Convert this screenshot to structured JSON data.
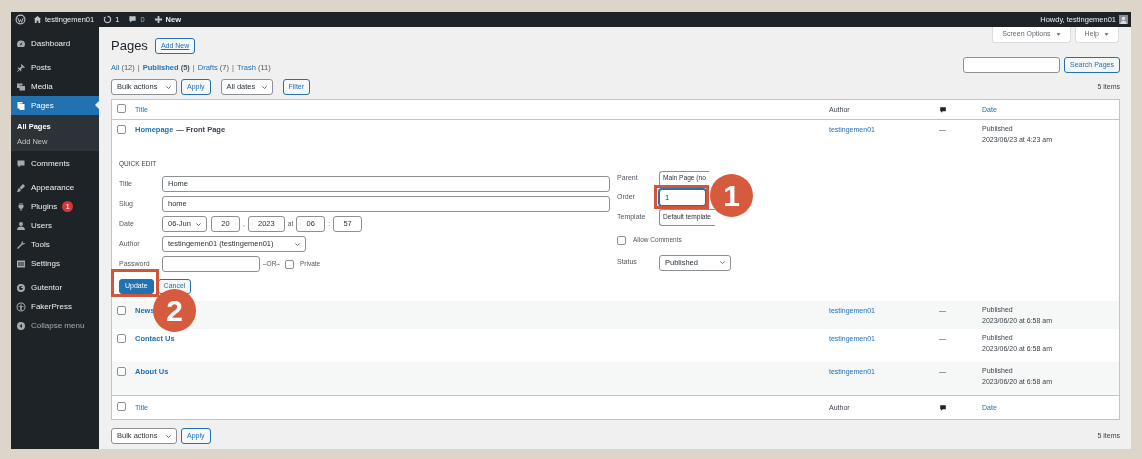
{
  "admin_bar": {
    "site_name": "testingemen01",
    "updates": "1",
    "comments": "0",
    "new_label": "New",
    "greeting": "Howdy, testingemen01"
  },
  "sidebar": {
    "groups": [
      {
        "items": [
          {
            "label": "Dashboard",
            "selected": false
          }
        ]
      },
      {
        "items": [
          {
            "label": "Posts",
            "selected": false
          },
          {
            "label": "Media",
            "selected": false
          },
          {
            "label": "Pages",
            "selected": true,
            "children": [
              {
                "label": "All Pages",
                "selected": true
              },
              {
                "label": "Add New",
                "selected": false
              }
            ]
          },
          {
            "label": "Comments",
            "selected": false
          }
        ]
      },
      {
        "items": [
          {
            "label": "Appearance",
            "selected": false
          },
          {
            "label": "Plugins",
            "selected": false,
            "badge": "1"
          },
          {
            "label": "Users",
            "selected": false
          },
          {
            "label": "Tools",
            "selected": false
          },
          {
            "label": "Settings",
            "selected": false
          }
        ]
      },
      {
        "items": [
          {
            "label": "Gutentor",
            "selected": false
          },
          {
            "label": "FakerPress",
            "selected": false
          },
          {
            "label": "Collapse menu",
            "selected": false,
            "kind": "collapse"
          }
        ]
      }
    ]
  },
  "screen_options": "Screen Options",
  "help": "Help",
  "page": {
    "title": "Pages",
    "add_new": "Add New"
  },
  "filters": [
    {
      "label": "All",
      "count": "(12)",
      "selected": false,
      "separator": "|"
    },
    {
      "label": "Published",
      "count": "(5)",
      "selected": true,
      "separator": "|"
    },
    {
      "label": "Drafts",
      "count": "(7)",
      "selected": false,
      "separator": "|"
    },
    {
      "label": "Trash",
      "count": "(11)",
      "selected": false
    }
  ],
  "search": {
    "button": "Search Pages"
  },
  "top_actions": {
    "bulk": "Bulk actions",
    "apply": "Apply",
    "dates": "All dates",
    "filter": "Filter",
    "count": "5 items"
  },
  "table": {
    "header": {
      "checked": false,
      "title": "Title",
      "author": "Author",
      "date": "Date"
    },
    "rows": [
      {
        "kind": "page",
        "checked": false,
        "title": "Homepage",
        "state": "— Front Page",
        "author": "testingemen01",
        "comments": "—",
        "status": "Published",
        "date": "2023/06/23 at 4:23 am"
      },
      {
        "kind": "quick_edit",
        "heading": "QUICK EDIT",
        "title_label": "Title",
        "title": "Home",
        "slug_label": "Slug",
        "slug": "home",
        "date_label": "Date",
        "month": "06-Jun",
        "day": "20",
        "day_sep": ",",
        "year": "2023",
        "at": "at",
        "hour": "06",
        "time_sep": ":",
        "minute": "57",
        "author_label": "Author",
        "author": "testingemen01 (testingemen01)",
        "password_label": "Password",
        "or": "–OR–",
        "private_label": "Private",
        "private": false,
        "parent_label": "Parent",
        "parent": "Main Page (no",
        "order_label": "Order",
        "order": "1",
        "template_label": "Template",
        "template": "Default template",
        "allow_comments_label": "Allow Comments",
        "allow_comments": false,
        "status_label": "Status",
        "status": "Published",
        "update": "Update",
        "cancel": "Cancel"
      },
      {
        "kind": "page",
        "checked": false,
        "title": "News",
        "author": "testingemen01",
        "comments": "—",
        "status": "Published",
        "date": "2023/06/20 at 6:58 am"
      },
      {
        "kind": "page",
        "checked": false,
        "title": "Contact Us",
        "author": "testingemen01",
        "comments": "—",
        "status": "Published",
        "date": "2023/06/20 at 6:58 am"
      },
      {
        "kind": "page",
        "checked": false,
        "title": "About Us",
        "author": "testingemen01",
        "comments": "—",
        "status": "Published",
        "date": "2023/06/20 at 6:58 am"
      }
    ],
    "footer": {
      "checked": false,
      "title": "Title",
      "author": "Author",
      "date": "Date"
    }
  },
  "bottom_actions": {
    "bulk": "Bulk actions",
    "apply": "Apply",
    "count": "5 items"
  },
  "annotations": [
    {
      "number": "1"
    },
    {
      "number": "2"
    }
  ]
}
